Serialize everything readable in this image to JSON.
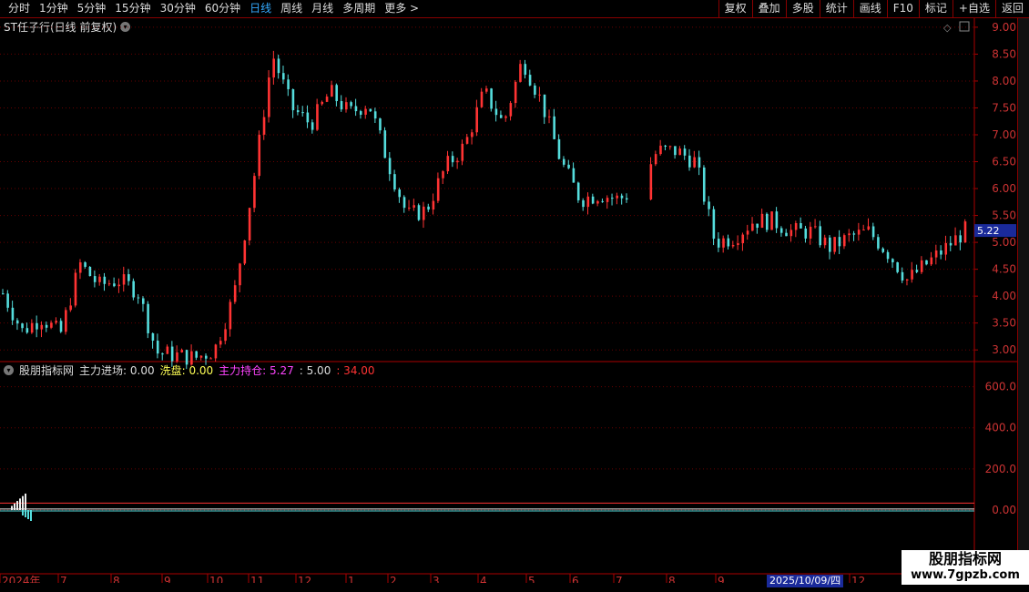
{
  "toolbar": {
    "periods": [
      "分时",
      "1分钟",
      "5分钟",
      "15分钟",
      "30分钟",
      "60分钟",
      "日线",
      "周线",
      "月线",
      "多周期",
      "更多 >"
    ],
    "active_period": "日线",
    "right_buttons": [
      "复权",
      "叠加",
      "多股",
      "统计",
      "画线",
      "F10",
      "标记",
      "+自选",
      "返回"
    ]
  },
  "title": "ST任子行(日线 前复权)",
  "price_axis": [
    "9.00",
    "8.50",
    "8.00",
    "7.50",
    "7.00",
    "6.50",
    "6.00",
    "5.50",
    "5.00",
    "4.50",
    "4.00",
    "3.50",
    "3.00"
  ],
  "current_price": "5.22",
  "indicator": {
    "name": "股朋指标网",
    "items": [
      {
        "label": "主力进场:",
        "value": "0.00",
        "color": "#dddddd"
      },
      {
        "label": "洗盘:",
        "value": "0.00",
        "color": "#ffff55"
      },
      {
        "label": "主力持仓:",
        "value": "5.27",
        "color": "#ff44ff"
      },
      {
        "label": ":",
        "value": "5.00",
        "color": "#dddddd"
      },
      {
        "label": ":",
        "value": "34.00",
        "color": "#ff3333"
      }
    ],
    "axis": [
      "600.0",
      "400.0",
      "200.0",
      "0.00"
    ]
  },
  "time_axis": [
    {
      "label": "2024年"
    },
    {
      "label": "7"
    },
    {
      "label": "8"
    },
    {
      "label": "9"
    },
    {
      "label": "10"
    },
    {
      "label": "11"
    },
    {
      "label": "12"
    },
    {
      "label": "1"
    },
    {
      "label": "2"
    },
    {
      "label": "3"
    },
    {
      "label": "4"
    },
    {
      "label": "5"
    },
    {
      "label": "6"
    },
    {
      "label": "7"
    },
    {
      "label": "8"
    },
    {
      "label": "9"
    },
    {
      "label": "12"
    }
  ],
  "date_badge": "2025/10/09/四",
  "watermark": {
    "line1": "股朋指标网",
    "line2": "www.7gpzb.com"
  },
  "chart_data": {
    "type": "candlestick",
    "title": "ST任子行(日线 前复权)",
    "ylim": [
      2.8,
      9.1
    ],
    "close": [
      4.05,
      3.35,
      3.6,
      3.3,
      4.6,
      4.2,
      4.3,
      4.1,
      2.95,
      2.9,
      2.85,
      3.0,
      4.0,
      6.1,
      8.5,
      7.5,
      7.2,
      7.8,
      7.4,
      7.6,
      6.5,
      5.5,
      5.6,
      6.4,
      6.8,
      7.8,
      7.2,
      8.4,
      7.6,
      6.5,
      5.8,
      5.9,
      5.8,
      6.0,
      6.7,
      6.7,
      6.5,
      5.0,
      5.1,
      5.4,
      5.4,
      5.2,
      5.2,
      4.9,
      5.1,
      5.2,
      4.8,
      4.3,
      4.6,
      4.9,
      5.22
    ],
    "colors": {
      "up": "#ff3333",
      "down": "#55dddd",
      "grid": "#660000"
    }
  }
}
